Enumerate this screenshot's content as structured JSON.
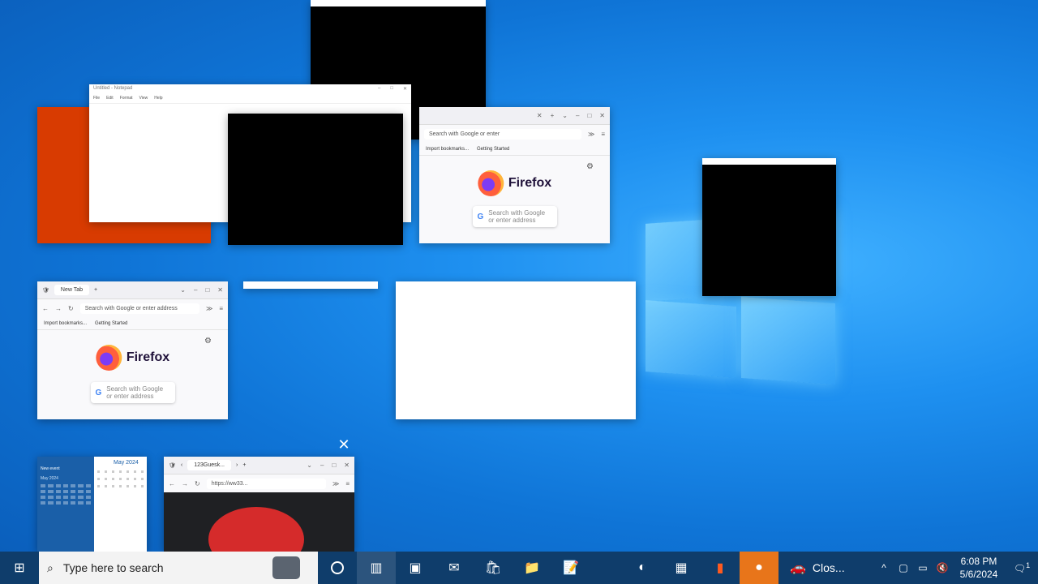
{
  "firefox": {
    "tab_label": "New Tab",
    "url_placeholder": "Search with Google or enter address",
    "bookmark_import": "Import bookmarks...",
    "bookmark_started": "Getting Started",
    "brand": "Firefox",
    "search_line1": "Search with Google",
    "search_line2": "or enter address",
    "search_short": "Search with Google or enter"
  },
  "notepad": {
    "title": "Untitled - Notepad",
    "menus": [
      "File",
      "Edit",
      "Format",
      "View",
      "Help"
    ]
  },
  "calendar": {
    "month": "May 2024",
    "new_event": "New event",
    "mini_month": "May 2024"
  },
  "browser2": {
    "tab_label": "123Guesk...",
    "url": "https://ww33..."
  },
  "taskbar": {
    "search_placeholder": "Type here to search",
    "tray_label": "Clos...",
    "time": "6:08 PM",
    "date": "5/6/2024",
    "notification_count": "1"
  },
  "icons": {
    "start": "windows-icon",
    "search": "magnifier-icon",
    "task_view": "task-view-icon",
    "close": "close-icon"
  },
  "colors": {
    "taskbar": "#0f3d6b",
    "desktop": "#1e90f0",
    "accent_orange": "#e8751a"
  }
}
